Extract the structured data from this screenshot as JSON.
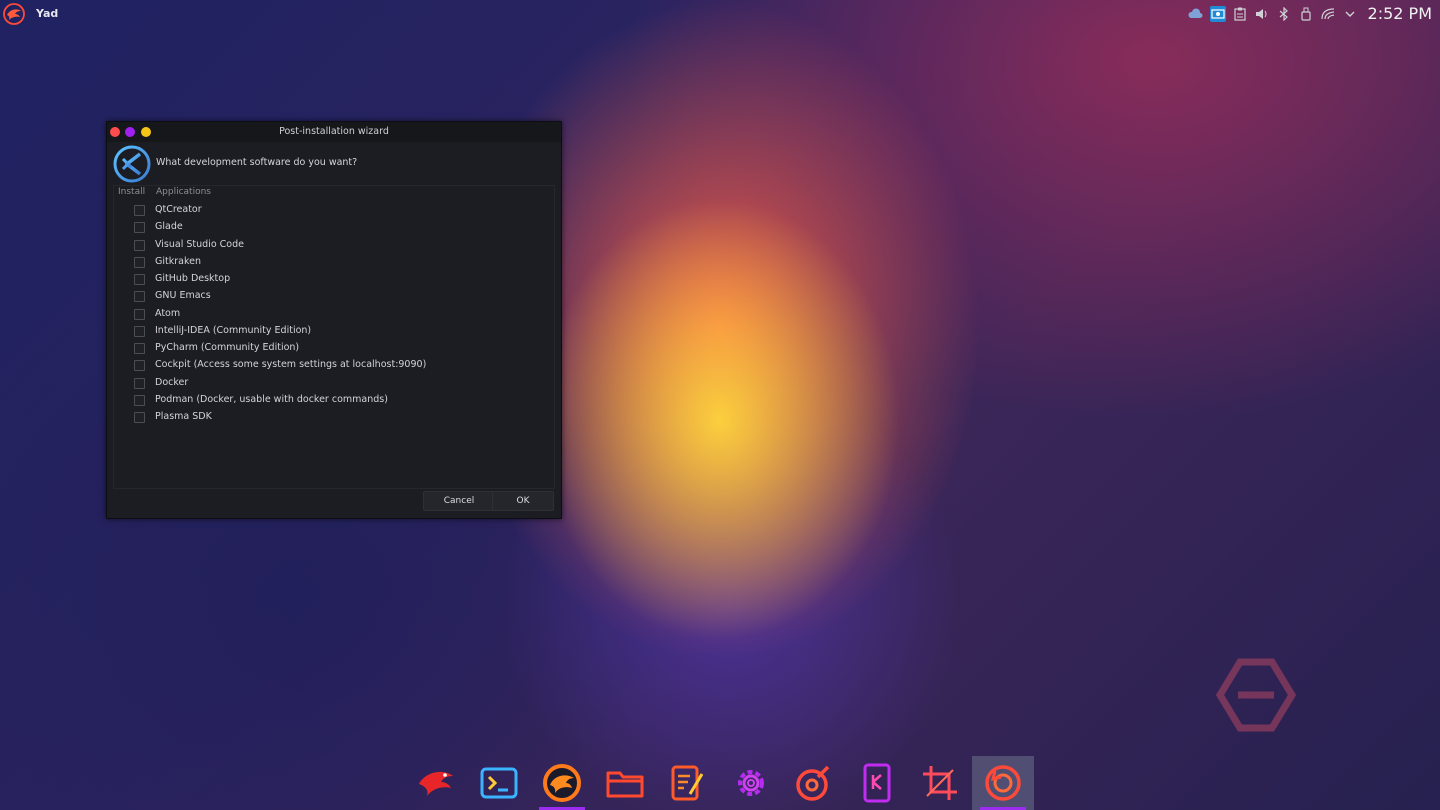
{
  "topbar": {
    "app_name": "Yad",
    "app_logo_icon": "garuda-eagle-icon",
    "tray_icons": [
      "weather-icon",
      "screen-capture-icon",
      "clipboard-icon",
      "volume-icon",
      "bluetooth-icon",
      "usb-device-icon",
      "wifi-icon",
      "chevron-down-icon"
    ],
    "clock": "2:52 PM"
  },
  "dialog": {
    "title": "Post-installation wizard",
    "question": "What development software do you want?",
    "columns": {
      "install": "Install",
      "applications": "Applications"
    },
    "items": [
      {
        "label": "QtCreator",
        "checked": false
      },
      {
        "label": "Glade",
        "checked": false
      },
      {
        "label": "Visual Studio Code",
        "checked": false
      },
      {
        "label": "Gitkraken",
        "checked": false
      },
      {
        "label": "GitHub Desktop",
        "checked": false
      },
      {
        "label": "GNU Emacs",
        "checked": false
      },
      {
        "label": "Atom",
        "checked": false
      },
      {
        "label": "IntelliJ-IDEA (Community Edition)",
        "checked": false
      },
      {
        "label": "PyCharm (Community Edition)",
        "checked": false
      },
      {
        "label": "Cockpit (Access some system settings at localhost:9090)",
        "checked": false
      },
      {
        "label": "Docker",
        "checked": false
      },
      {
        "label": "Podman (Docker, usable with docker commands)",
        "checked": false
      },
      {
        "label": "Plasma SDK",
        "checked": false
      }
    ],
    "cancel_label": "Cancel",
    "ok_label": "OK"
  },
  "dock": {
    "items": [
      {
        "name": "garuda-launcher-icon",
        "active": false,
        "running": false
      },
      {
        "name": "terminal-icon",
        "active": false,
        "running": false
      },
      {
        "name": "garuda-welcome-icon",
        "active": false,
        "running": true
      },
      {
        "name": "file-manager-icon",
        "active": false,
        "running": false
      },
      {
        "name": "text-editor-icon",
        "active": false,
        "running": false
      },
      {
        "name": "settings-gear-icon",
        "active": false,
        "running": false
      },
      {
        "name": "music-player-icon",
        "active": false,
        "running": false
      },
      {
        "name": "kde-connect-icon",
        "active": false,
        "running": false
      },
      {
        "name": "crop-tool-icon",
        "active": false,
        "running": false
      },
      {
        "name": "timeshift-restore-icon",
        "active": true,
        "running": true
      }
    ]
  },
  "colors": {
    "close": "#ff4d4d",
    "minimize": "#a020f0",
    "maximize": "#f5c518",
    "accent": "#9c2cf0",
    "dock_orange": "#ff6a2a"
  }
}
